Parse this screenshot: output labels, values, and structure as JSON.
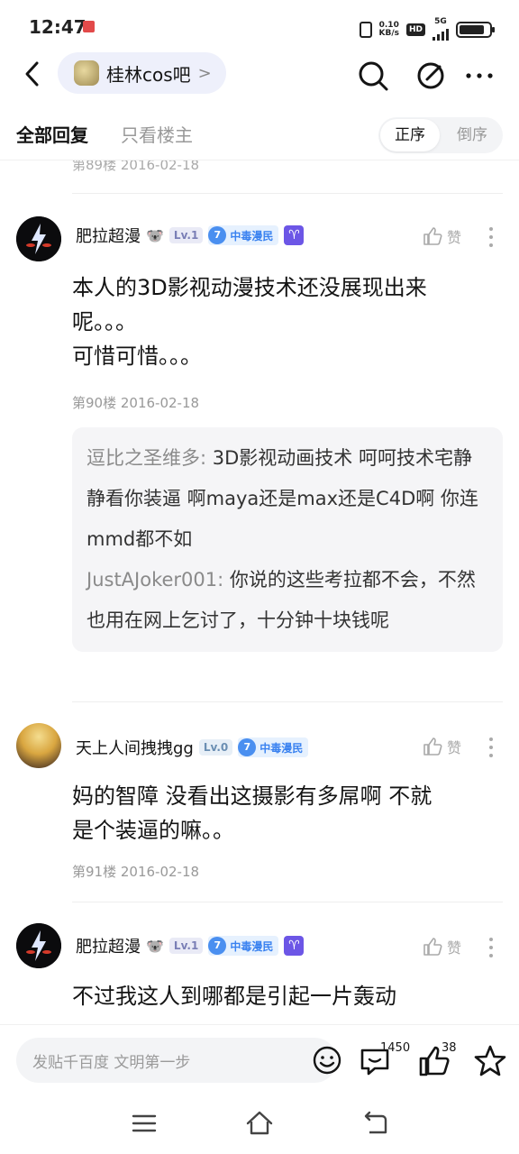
{
  "status_bar": {
    "time": "12:47",
    "net_speed": "0.10",
    "net_unit": "KB/s",
    "hd": "HD",
    "network": "5G"
  },
  "nav": {
    "forum_name": "桂林cos吧",
    "forum_chevron": ">"
  },
  "filter": {
    "all_replies": "全部回复",
    "op_only": "只看楼主",
    "sort_asc": "正序",
    "sort_desc": "倒序"
  },
  "prev_meta": "第89楼  2016-02-18",
  "posts": [
    {
      "username": "肥拉超漫",
      "badge_emoji": "🐨",
      "level": "Lv.1",
      "fans_level": "7",
      "fans_title": "中毒漫民",
      "zodiac": "♈",
      "like_label": "赞",
      "content_lines": [
        "本人的3D影视动漫技术还没展现出来",
        "呢。。。",
        "可惜可惜。。。"
      ],
      "meta": "第90楼  2016-02-18",
      "replies": [
        {
          "name": "逗比之圣维多:",
          "text": " 3D影视动画技术 呵呵技术宅静静看你装逼 啊maya还是max还是C4D啊 你连mmd都不如"
        },
        {
          "name": "JustAJoker001:",
          "text": " 你说的这些考拉都不会，不然也用在网上乞讨了，十分钟十块钱呢"
        }
      ]
    },
    {
      "username": "天上人间拽拽gg",
      "level": "Lv.0",
      "fans_level": "7",
      "fans_title": "中毒漫民",
      "like_label": "赞",
      "content_lines": [
        "妈的智障 没看出这摄影有多屌啊 不就",
        "是个装逼的嘛。。"
      ],
      "meta": "第91楼  2016-02-18"
    },
    {
      "username": "肥拉超漫",
      "badge_emoji": "🐨",
      "level": "Lv.1",
      "fans_level": "7",
      "fans_title": "中毒漫民",
      "zodiac": "♈",
      "like_label": "赞",
      "content_lines": [
        "不过我这人到哪都是引起一片轰动"
      ]
    }
  ],
  "bottom_bar": {
    "reply_placeholder": "发贴千百度 文明第一步",
    "comment_count": "1450",
    "like_count": "38"
  },
  "colors": {
    "accent_blue": "#3a82f0",
    "zodiac_purple": "#6c56e6",
    "text_primary": "#141414",
    "text_muted": "#999999"
  }
}
